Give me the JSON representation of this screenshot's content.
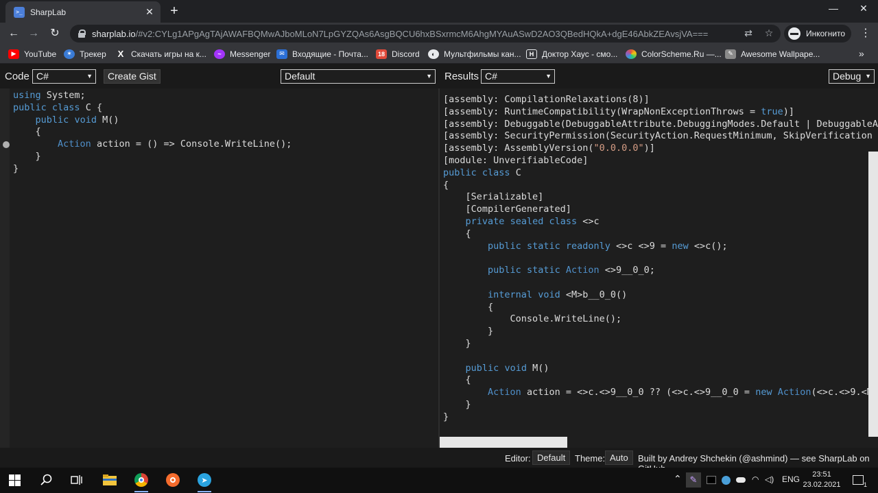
{
  "browser": {
    "tab": {
      "title": "SharpLab",
      "favicon": "sharplab-icon"
    },
    "address": {
      "host": "sharplab.io",
      "path": "/#v2:CYLg1APgAgTAjAWAFBQMwAJboMLoN7LpGYZQAs6AsgBQCU6hxBSxrmcM6AhgMYAuASwD2AO3QBedHQkA+dgE46AbkZEAvsjVA==="
    },
    "incognito_label": "Инкогнито",
    "bookmarks": [
      {
        "label": "YouTube",
        "icon": "youtube-icon",
        "color": "#ff0000"
      },
      {
        "label": "Трекер",
        "icon": "tracker-icon",
        "color": "#3a7bd5"
      },
      {
        "label": "Скачать игры на к...",
        "icon": "x-icon",
        "color": "#35363a"
      },
      {
        "label": "Messenger",
        "icon": "messenger-icon",
        "color": "#a334fa"
      },
      {
        "label": "Входящие - Почта...",
        "icon": "mail-icon",
        "color": "#2b6fd6"
      },
      {
        "label": "Discord",
        "icon": "discord-icon",
        "color": "#e04a3a"
      },
      {
        "label": "Мультфильмы кан...",
        "icon": "globe-icon",
        "color": "#e8eaed"
      },
      {
        "label": "Доктор Хаус - смо...",
        "icon": "h-icon",
        "color": "#35363a"
      },
      {
        "label": "ColorScheme.Ru —...",
        "icon": "colorscheme-icon",
        "color": "#e2553b"
      },
      {
        "label": "Awesome Wallpape...",
        "icon": "wallpaper-icon",
        "color": "#8a8a8a"
      }
    ]
  },
  "app": {
    "code_label": "Code",
    "language": "C#",
    "create_gist": "Create Gist",
    "branch": "Default",
    "results_label": "Results",
    "target": "C#",
    "mode": "Debug",
    "footer": {
      "editor_label": "Editor:",
      "editor_value": "Default",
      "theme_label": "Theme:",
      "theme_value": "Auto",
      "credit": "Built by Andrey Shchekin (@ashmind) — see SharpLab on GitHub."
    }
  },
  "taskbar": {
    "lang": "ENG",
    "time": "23:51",
    "date": "23.02.2021",
    "notification_count": "1"
  }
}
